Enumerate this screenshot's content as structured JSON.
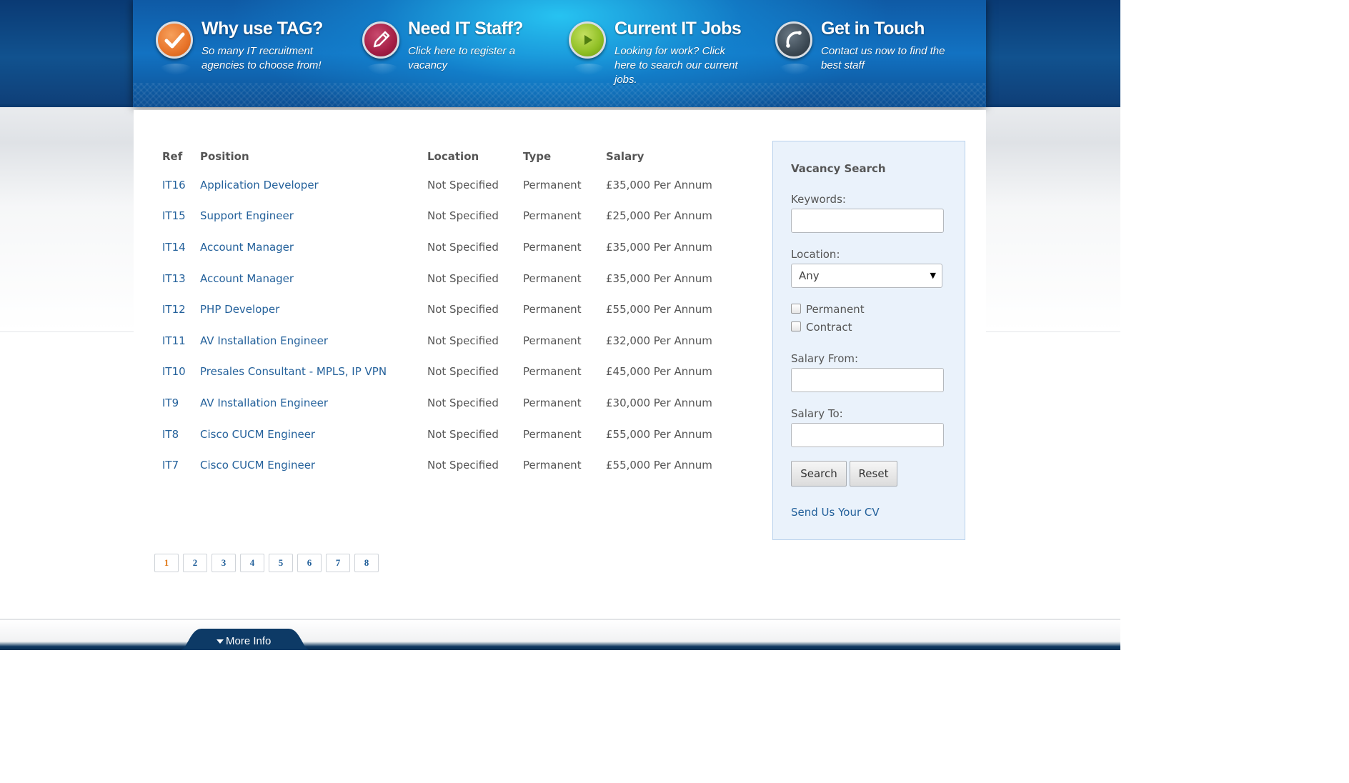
{
  "header": {
    "features": [
      {
        "title": "Why use TAG?",
        "desc": "So many IT recruitment agencies to choose from!",
        "icon": "check-icon",
        "color": "#e8742a"
      },
      {
        "title": "Need IT Staff?",
        "desc": "Click here to register a vacancy",
        "icon": "pencil-icon",
        "color": "#a41e45"
      },
      {
        "title": "Current IT Jobs",
        "desc": "Looking for work? Click here to search our current jobs.",
        "icon": "play-icon",
        "color": "#8fbf24"
      },
      {
        "title": "Get in Touch",
        "desc": "Contact us now to find the best staff",
        "icon": "phone-icon",
        "color": "#3d4a55"
      }
    ]
  },
  "jobs": {
    "columns": {
      "ref": "Ref",
      "position": "Position",
      "location": "Location",
      "type": "Type",
      "salary": "Salary"
    },
    "rows": [
      {
        "ref": "IT16",
        "position": "Application Developer",
        "location": "Not Specified",
        "type": "Permanent",
        "salary": "£35,000 Per Annum"
      },
      {
        "ref": "IT15",
        "position": "Support Engineer",
        "location": "Not Specified",
        "type": "Permanent",
        "salary": "£25,000 Per Annum"
      },
      {
        "ref": "IT14",
        "position": "Account Manager",
        "location": "Not Specified",
        "type": "Permanent",
        "salary": "£35,000 Per Annum"
      },
      {
        "ref": "IT13",
        "position": "Account Manager",
        "location": "Not Specified",
        "type": "Permanent",
        "salary": "£35,000 Per Annum"
      },
      {
        "ref": "IT12",
        "position": "PHP Developer",
        "location": "Not Specified",
        "type": "Permanent",
        "salary": "£55,000 Per Annum"
      },
      {
        "ref": "IT11",
        "position": "AV Installation Engineer",
        "location": "Not Specified",
        "type": "Permanent",
        "salary": "£32,000 Per Annum"
      },
      {
        "ref": "IT10",
        "position": "Presales Consultant - MPLS, IP VPN",
        "location": "Not Specified",
        "type": "Permanent",
        "salary": "£45,000 Per Annum"
      },
      {
        "ref": "IT9",
        "position": "AV Installation Engineer",
        "location": "Not Specified",
        "type": "Permanent",
        "salary": "£30,000 Per Annum"
      },
      {
        "ref": "IT8",
        "position": "Cisco CUCM Engineer",
        "location": "Not Specified",
        "type": "Permanent",
        "salary": "£55,000 Per Annum"
      },
      {
        "ref": "IT7",
        "position": "Cisco CUCM Engineer",
        "location": "Not Specified",
        "type": "Permanent",
        "salary": "£55,000 Per Annum"
      }
    ]
  },
  "pagination": {
    "pages": [
      "1",
      "2",
      "3",
      "4",
      "5",
      "6",
      "7",
      "8"
    ],
    "current": "1"
  },
  "search": {
    "heading": "Vacancy Search",
    "keywords_label": "Keywords:",
    "keywords_value": "",
    "location_label": "Location:",
    "location_value": "Any",
    "permanent_label": "Permanent",
    "contract_label": "Contract",
    "salary_from_label": "Salary From:",
    "salary_from_value": "",
    "salary_to_label": "Salary To:",
    "salary_to_value": "",
    "search_button": "Search",
    "reset_button": "Reset",
    "cv_link": "Send Us Your CV"
  },
  "footer": {
    "more_info": "More Info"
  },
  "colors": {
    "link": "#24619b",
    "active_page": "#e07a1a",
    "panel_bg": "#eaf2fb"
  }
}
